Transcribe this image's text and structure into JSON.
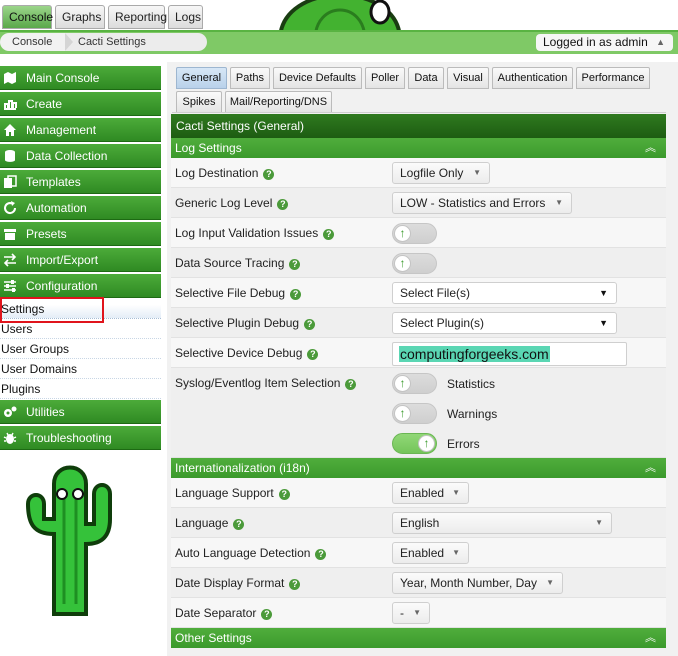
{
  "top_tabs": [
    "Console",
    "Graphs",
    "Reporting",
    "Logs"
  ],
  "breadcrumb": [
    "Console",
    "Cacti Settings"
  ],
  "user": {
    "label": "Logged in as admin"
  },
  "nav": {
    "items": [
      {
        "label": "Main Console",
        "icon": "map-icon"
      },
      {
        "label": "Create",
        "icon": "chart-icon"
      },
      {
        "label": "Management",
        "icon": "home-icon"
      },
      {
        "label": "Data Collection",
        "icon": "database-icon"
      },
      {
        "label": "Templates",
        "icon": "copy-icon"
      },
      {
        "label": "Automation",
        "icon": "refresh-icon"
      },
      {
        "label": "Presets",
        "icon": "archive-icon"
      },
      {
        "label": "Import/Export",
        "icon": "exchange-icon"
      },
      {
        "label": "Configuration",
        "icon": "sliders-icon"
      }
    ],
    "config_subitems": [
      "Settings",
      "Users",
      "User Groups",
      "User Domains",
      "Plugins"
    ],
    "utilities": {
      "label": "Utilities",
      "icon": "gears-icon"
    },
    "troubleshooting": {
      "label": "Troubleshooting",
      "icon": "bug-icon"
    }
  },
  "settings_tabs": [
    "General",
    "Paths",
    "Device Defaults",
    "Poller",
    "Data",
    "Visual",
    "Authentication",
    "Performance",
    "Spikes",
    "Mail/Reporting/DNS"
  ],
  "panel_title": "Cacti Settings (General)",
  "log_section": {
    "title": "Log Settings",
    "log_destination": {
      "label": "Log Destination",
      "value": "Logfile Only"
    },
    "generic_log_level": {
      "label": "Generic Log Level",
      "value": "LOW - Statistics and Errors"
    },
    "log_input_validation": {
      "label": "Log Input Validation Issues"
    },
    "data_source_tracing": {
      "label": "Data Source Tracing"
    },
    "selective_file_debug": {
      "label": "Selective File Debug",
      "value": "Select File(s)"
    },
    "selective_plugin_debug": {
      "label": "Selective Plugin Debug",
      "value": "Select Plugin(s)"
    },
    "selective_device_debug": {
      "label": "Selective Device Debug",
      "value": "computingforgeeks.com"
    },
    "syslog": {
      "label": "Syslog/Eventlog Item Selection",
      "options": [
        {
          "label": "Statistics",
          "on": false
        },
        {
          "label": "Warnings",
          "on": false
        },
        {
          "label": "Errors",
          "on": true
        }
      ]
    }
  },
  "i18n_section": {
    "title": "Internationalization (i18n)",
    "language_support": {
      "label": "Language Support",
      "value": "Enabled"
    },
    "language": {
      "label": "Language",
      "value": "English"
    },
    "auto_language_detection": {
      "label": "Auto Language Detection",
      "value": "Enabled"
    },
    "date_display_format": {
      "label": "Date Display Format",
      "value": "Year, Month Number, Day"
    },
    "date_separator": {
      "label": "Date Separator",
      "value": "-"
    }
  },
  "other_section": {
    "title": "Other Settings"
  },
  "colors": {
    "nav_green": "#3b9a2c",
    "title_green": "#1d5c12",
    "highlight_red": "#e0141c",
    "device_debug_highlight": "#5ad6b3"
  }
}
